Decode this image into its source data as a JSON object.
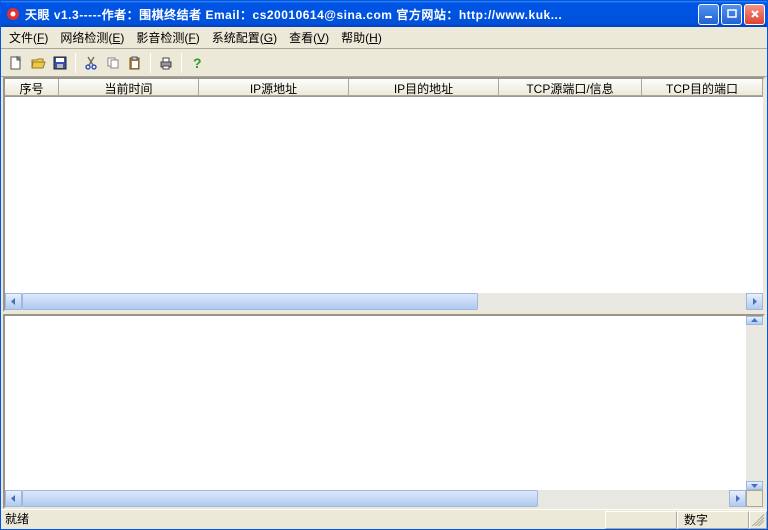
{
  "title": "天眼  v1.3-----作者：围棋终结者   Email：cs20010614@sina.com   官方网站：http://www.kuk...",
  "menu": {
    "file": {
      "label": "文件",
      "key": "F"
    },
    "netdet": {
      "label": "网络检测",
      "key": "E"
    },
    "media": {
      "label": "影音检测",
      "key": "F"
    },
    "syscfg": {
      "label": "系统配置",
      "key": "G"
    },
    "view": {
      "label": "查看",
      "key": "V"
    },
    "help": {
      "label": "帮助",
      "key": "H"
    }
  },
  "cols": {
    "seq": "序号",
    "time": "当前时间",
    "srcip": "IP源地址",
    "dstip": "IP目的地址",
    "tcpsrc": "TCP源端口/信息",
    "tcpdst": "TCP目的端口"
  },
  "status": {
    "ready": "就绪",
    "num": "数字"
  },
  "colors": {
    "titlebar": "#0054E3",
    "close": "#E14230",
    "panel": "#ECE9D8",
    "thumb": "#AFC9EF"
  }
}
